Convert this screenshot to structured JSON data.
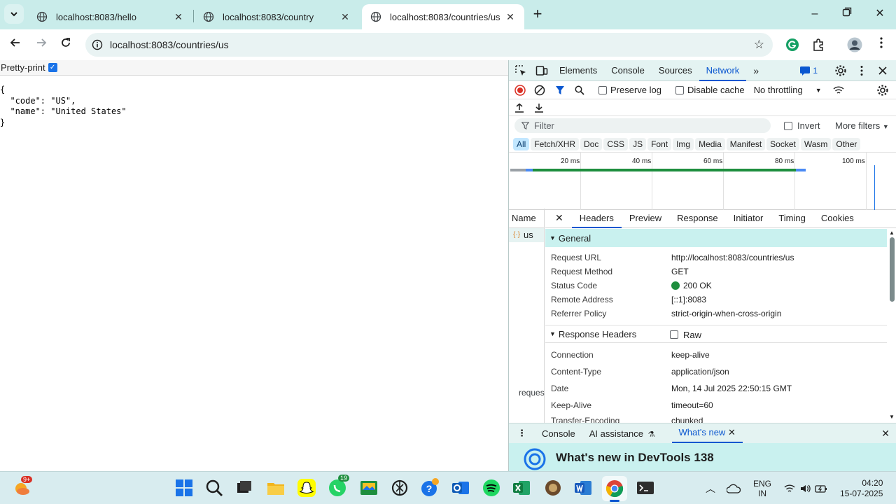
{
  "browser": {
    "tabs": [
      {
        "title": "localhost:8083/hello"
      },
      {
        "title": "localhost:8083/country"
      },
      {
        "title": "localhost:8083/countries/us"
      }
    ],
    "address": "localhost:8083/countries/us"
  },
  "page": {
    "pretty_print_label": "Pretty-print",
    "json_text": "{\n  \"code\": \"US\",\n  \"name\": \"United States\"\n}"
  },
  "devtools": {
    "panels": [
      "Elements",
      "Console",
      "Sources",
      "Network"
    ],
    "active_panel": "Network",
    "issues_count": "1",
    "preserve_log": "Preserve log",
    "disable_cache": "Disable cache",
    "throttling": "No throttling",
    "filter_placeholder": "Filter",
    "invert": "Invert",
    "more_filters": "More filters",
    "type_filters": [
      "All",
      "Fetch/XHR",
      "Doc",
      "CSS",
      "JS",
      "Font",
      "Img",
      "Media",
      "Manifest",
      "Socket",
      "Wasm",
      "Other"
    ],
    "timeline_labels": [
      "20 ms",
      "40 ms",
      "60 ms",
      "80 ms",
      "100 ms"
    ],
    "name_header": "Name",
    "request_name": "us",
    "footer_truncated": "reques",
    "detail_tabs": [
      "Headers",
      "Preview",
      "Response",
      "Initiator",
      "Timing",
      "Cookies"
    ],
    "general": {
      "title": "General",
      "rows": [
        {
          "k": "Request URL",
          "v": "http://localhost:8083/countries/us"
        },
        {
          "k": "Request Method",
          "v": "GET"
        },
        {
          "k": "Status Code",
          "v": "200 OK"
        },
        {
          "k": "Remote Address",
          "v": "[::1]:8083"
        },
        {
          "k": "Referrer Policy",
          "v": "strict-origin-when-cross-origin"
        }
      ]
    },
    "response_headers": {
      "title": "Response Headers",
      "raw": "Raw",
      "rows": [
        {
          "k": "Connection",
          "v": "keep-alive"
        },
        {
          "k": "Content-Type",
          "v": "application/json"
        },
        {
          "k": "Date",
          "v": "Mon, 14 Jul 2025 22:50:15 GMT"
        },
        {
          "k": "Keep-Alive",
          "v": "timeout=60"
        },
        {
          "k": "Transfer-Encoding",
          "v": "chunked"
        }
      ]
    },
    "drawer": {
      "tabs": [
        "Console",
        "AI assistance",
        "What's new"
      ],
      "headline": "What's new in DevTools 138"
    }
  },
  "taskbar": {
    "weather_badge": "9+",
    "whatsapp_badge": "19",
    "lang_top": "ENG",
    "lang_bottom": "IN",
    "time": "04:20",
    "date": "15-07-2025"
  },
  "colors": {
    "accent": "#0b57d0",
    "tab_strip": "#c9ecea",
    "status_ok": "#1e8e3e",
    "record_red": "#d93025"
  }
}
